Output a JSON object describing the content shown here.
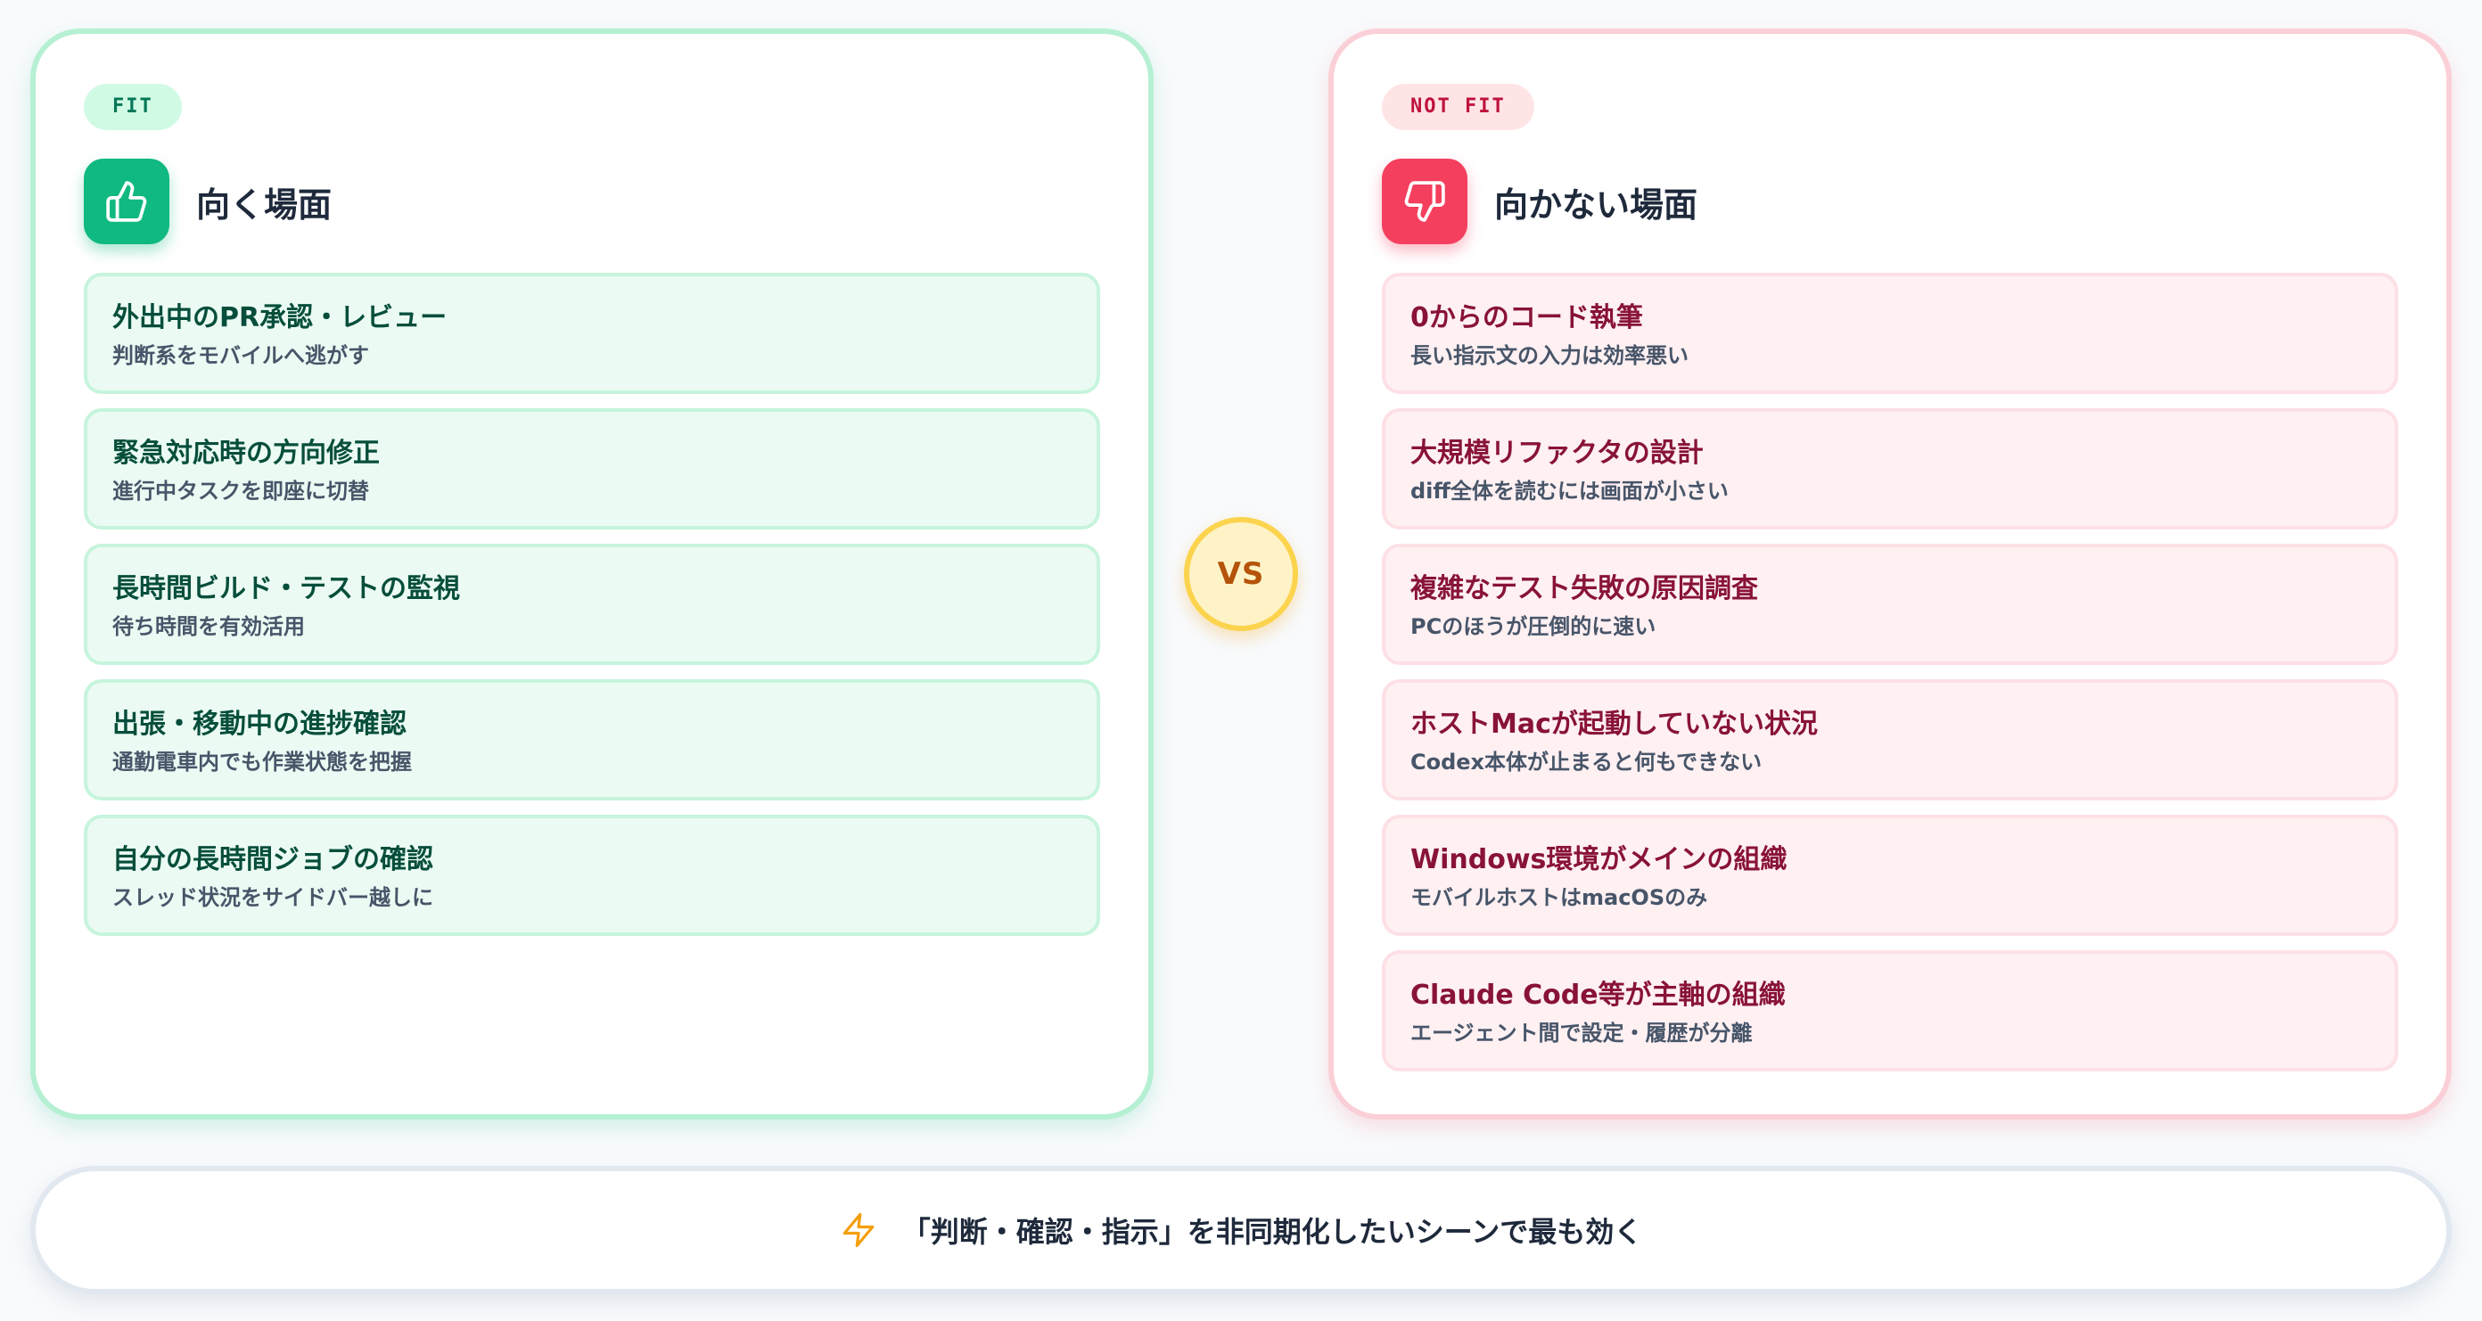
{
  "fit": {
    "tag": "FIT",
    "title": "向く場面",
    "icon": "thumbs-up-icon",
    "items": [
      {
        "title": "外出中のPR承認・レビュー",
        "sub": "判断系をモバイルへ逃がす"
      },
      {
        "title": "緊急対応時の方向修正",
        "sub": "進行中タスクを即座に切替"
      },
      {
        "title": "長時間ビルド・テストの監視",
        "sub": "待ち時間を有効活用"
      },
      {
        "title": "出張・移動中の進捗確認",
        "sub": "通勤電車内でも作業状態を把握"
      },
      {
        "title": "自分の長時間ジョブの確認",
        "sub": "スレッド状況をサイドバー越しに"
      }
    ]
  },
  "notfit": {
    "tag": "NOT FIT",
    "title": "向かない場面",
    "icon": "thumbs-down-icon",
    "items": [
      {
        "title": "0からのコード執筆",
        "sub": "長い指示文の入力は効率悪い"
      },
      {
        "title": "大規模リファクタの設計",
        "sub": "diff全体を読むには画面が小さい"
      },
      {
        "title": "複雑なテスト失敗の原因調査",
        "sub": "PCのほうが圧倒的に速い"
      },
      {
        "title": "ホストMacが起動していない状況",
        "sub": "Codex本体が止まると何もできない"
      },
      {
        "title": "Windows環境がメインの組織",
        "sub": "モバイルホストはmacOSのみ"
      },
      {
        "title": "Claude Code等が主軸の組織",
        "sub": "エージェント間で設定・履歴が分離"
      }
    ]
  },
  "vs": "VS",
  "footer": {
    "icon": "lightning-icon",
    "text": "「判断・確認・指示」を非同期化したいシーンで最も効く"
  },
  "colors": {
    "fit_accent": "#10b981",
    "notfit_accent": "#f43f5e",
    "vs_accent": "#fcd34d"
  }
}
